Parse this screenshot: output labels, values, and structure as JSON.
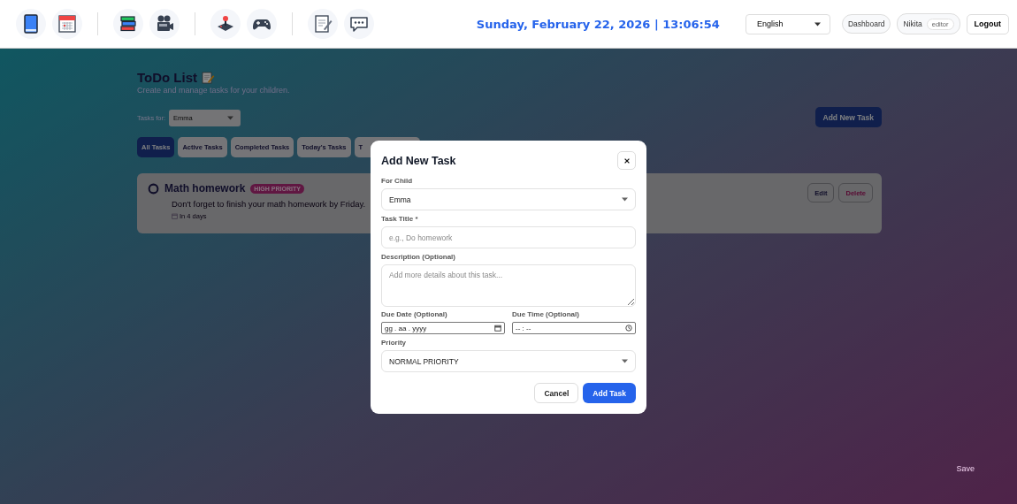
{
  "nav_groups": [
    [
      {
        "kind": "book"
      },
      {
        "kind": "calendar"
      }
    ],
    [
      {
        "kind": "books"
      },
      {
        "kind": "camera"
      }
    ],
    [
      {
        "kind": "joystick"
      },
      {
        "kind": "gamepad"
      }
    ],
    [
      {
        "kind": "notepad"
      },
      {
        "kind": "chat"
      }
    ]
  ],
  "datetime": "Sunday, February 22, 2026 | 13:06:54",
  "language": "English",
  "dashboard": "Dashboard",
  "user": {
    "name": "Nikita",
    "role": "editor"
  },
  "logout": "Logout",
  "page": {
    "title": "ToDo List",
    "subtitle": "Create and manage tasks for your children.",
    "child_filter": {
      "label": "Tasks for:",
      "value": "Emma"
    },
    "add_button": "Add New Task",
    "tabs": [
      {
        "label": "All Tasks",
        "selected": true
      },
      {
        "label": "Active Tasks",
        "selected": false
      },
      {
        "label": "Completed Tasks",
        "selected": false
      },
      {
        "label": "Today's Tasks",
        "selected": false
      },
      {
        "label": "T",
        "selected": false
      }
    ],
    "tasks": [
      {
        "title": "Math homework",
        "priority": "HIGH PRIORITY",
        "description": "Don't forget to finish your math homework by Friday.",
        "due": "In 4 days",
        "completed": false,
        "actions": [
          {
            "label": "Edit",
            "kind": "edit"
          },
          {
            "label": "Delete",
            "kind": "delete"
          }
        ]
      }
    ],
    "save": "Save"
  },
  "modal": {
    "title": "Add New Task",
    "fields": [
      {
        "kind": "select",
        "label": "For Child",
        "value": "Emma"
      },
      {
        "kind": "text",
        "label": "Task Title *",
        "placeholder": "e.g., Do homework"
      },
      {
        "kind": "textarea",
        "label": "Description (Optional)",
        "placeholder": "Add more details about this task..."
      },
      {
        "kind": "date",
        "label": "Due Date (Optional)",
        "value": "gg . aa . yyyy"
      },
      {
        "kind": "time",
        "label": "Due Time (Optional)",
        "value": "-- : --"
      },
      {
        "kind": "select",
        "label": "Priority",
        "value": "NORMAL PRIORITY"
      }
    ],
    "buttons": [
      {
        "label": "Cancel",
        "kind": "secondary"
      },
      {
        "label": "Add Task",
        "kind": "primary"
      }
    ]
  }
}
